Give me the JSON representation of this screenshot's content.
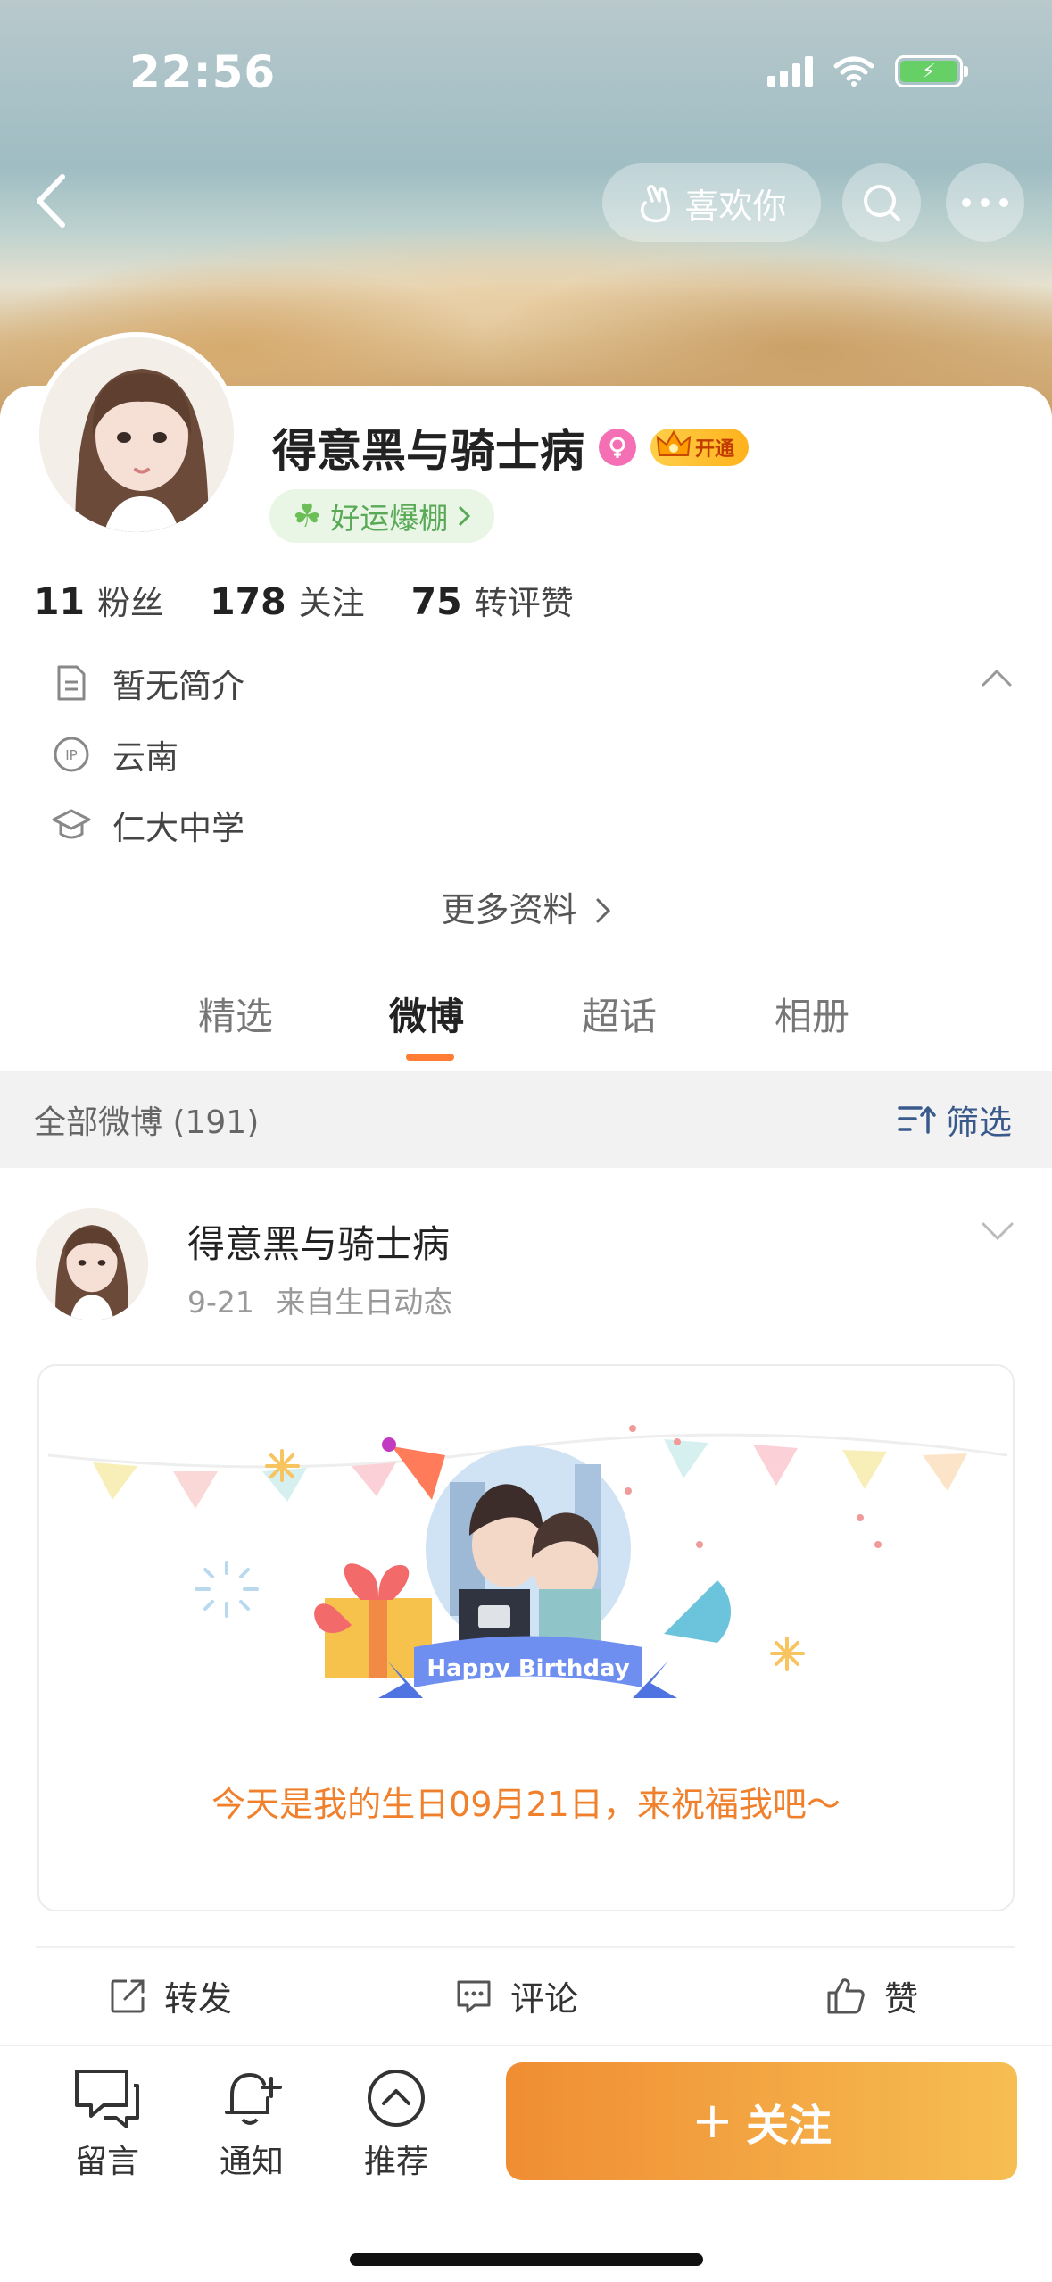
{
  "status_bar": {
    "time": "22:56"
  },
  "header": {
    "like_label": "喜欢你"
  },
  "profile": {
    "name": "得意黑与骑士病",
    "vip_label": "开通",
    "luck_label": "好运爆棚",
    "stats": [
      {
        "num": "11",
        "label": "粉丝"
      },
      {
        "num": "178",
        "label": "关注"
      },
      {
        "num": "75",
        "label": "转评赞"
      }
    ],
    "bio": "暂无简介",
    "location": "云南",
    "school": "仁大中学",
    "more_info": "更多资料"
  },
  "tabs": [
    {
      "label": "精选"
    },
    {
      "label": "微博"
    },
    {
      "label": "超话"
    },
    {
      "label": "相册"
    }
  ],
  "filter_bar": {
    "count_label": "全部微博 (191)",
    "filter_label": "筛选"
  },
  "post": {
    "author": "得意黑与骑士病",
    "date": "9-21",
    "source": "来自生日动态",
    "banner_text": "Happy Birthday",
    "birthday_text": "今天是我的生日09月21日，来祝福我吧～",
    "actions": {
      "repost": "转发",
      "comment": "评论",
      "like": "赞"
    }
  },
  "bottom_bar": {
    "message": "留言",
    "notify": "通知",
    "recommend": "推荐",
    "follow": "关注"
  },
  "colors": {
    "accent": "#ff7d34",
    "follow_start": "#f08d33",
    "follow_end": "#f6be52",
    "luck_green": "#59a957"
  }
}
